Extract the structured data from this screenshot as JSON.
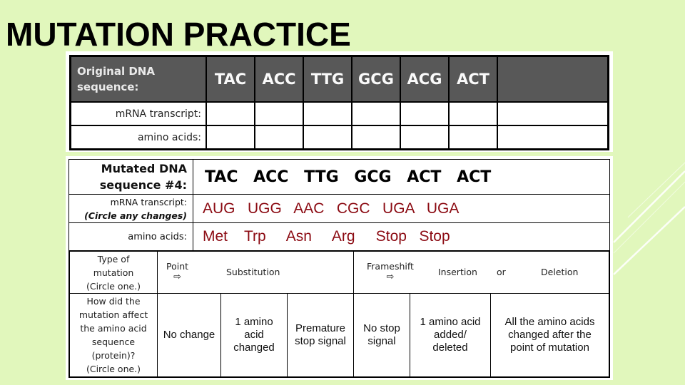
{
  "title": "MUTATION PRACTICE",
  "original_table": {
    "label_line1": "Original DNA",
    "label_line2": "sequence:",
    "codons": [
      "TAC",
      "ACC",
      "TTG",
      "GCG",
      "ACG",
      "ACT",
      ""
    ],
    "mrna_label": "mRNA transcript:",
    "amino_label": "amino acids:"
  },
  "mutated_table": {
    "label_line1": "Mutated DNA",
    "label_line2": "sequence #4:",
    "dna_sequence": "TAC ACC TTG GCG ACT ACT",
    "mrna_label": "m​RNA transcript:",
    "mrna_note": "(Circle any changes)",
    "mrna_sequence": "AUG   UGG   AAC   CGC   UGA   UGA",
    "amino_label": "amino acids:",
    "amino_sequence": "Met    Trp     Asn     Arg     Stop   Stop",
    "type_label_line1": "Type of",
    "type_label_line2": "mutation",
    "type_label_line3": "(Circle one.)",
    "point_label": "Point",
    "point_arrow": "⇨",
    "substitution_label": "Substitution",
    "frameshift_label": "Frameshift",
    "frameshift_arrow": "⇨",
    "insertion_label": "Insertion",
    "or_label": "or",
    "deletion_label": "Deletion",
    "effect_label": [
      "How did the",
      "mutation affect",
      "the amino acid",
      "sequence",
      "(protein)?",
      "(Circle one.)"
    ],
    "effect_options": [
      [
        "No change"
      ],
      [
        "1 amino",
        "acid",
        "changed"
      ],
      [
        "Premature",
        "stop signal"
      ],
      [
        "No stop",
        "signal"
      ],
      [
        "1 amino acid",
        "added/",
        "deleted"
      ],
      [
        "All the amino acids",
        "changed after the",
        "point of mutation"
      ]
    ]
  }
}
